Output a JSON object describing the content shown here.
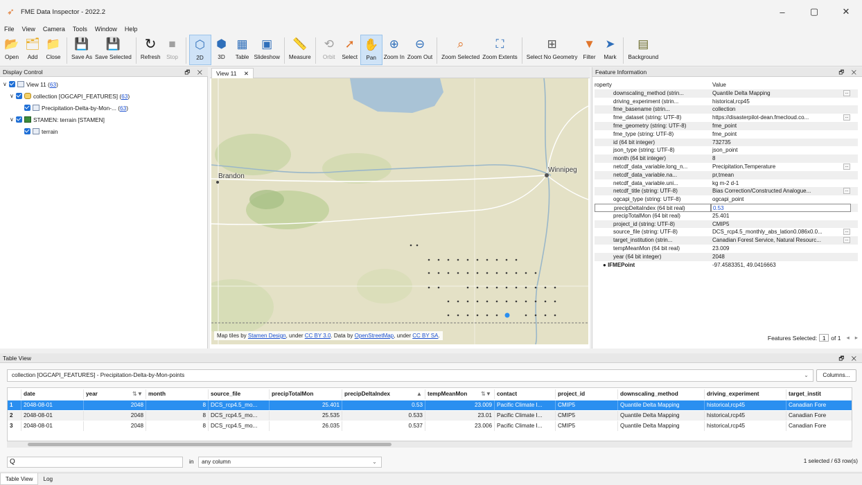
{
  "window": {
    "title": "FME Data Inspector - 2022.2",
    "controls": [
      "–",
      "▢",
      "✕"
    ]
  },
  "menu": [
    "File",
    "View",
    "Camera",
    "Tools",
    "Window",
    "Help"
  ],
  "toolbar": [
    {
      "label": "Open",
      "icon": "folder-open-icon",
      "glyph": "📂"
    },
    {
      "label": "Add",
      "icon": "add-icon",
      "glyph": "🗂"
    },
    {
      "label": "Close",
      "icon": "close-folder-icon",
      "glyph": "📁"
    },
    {
      "label": "Save As",
      "icon": "save-as-icon",
      "glyph": "💾"
    },
    {
      "label": "Save Selected",
      "icon": "save-selected-icon",
      "glyph": "💾"
    },
    {
      "label": "Refresh",
      "icon": "refresh-icon",
      "glyph": "↻"
    },
    {
      "label": "Stop",
      "icon": "stop-icon",
      "glyph": "■"
    },
    {
      "label": "2D",
      "icon": "2d-icon",
      "glyph": "⬡"
    },
    {
      "label": "3D",
      "icon": "3d-icon",
      "glyph": "⬢"
    },
    {
      "label": "Table",
      "icon": "table-icon",
      "glyph": "▦"
    },
    {
      "label": "Slideshow",
      "icon": "slideshow-icon",
      "glyph": "▣"
    },
    {
      "label": "Measure",
      "icon": "measure-icon",
      "glyph": "📏"
    },
    {
      "label": "Orbit",
      "icon": "orbit-icon",
      "glyph": "⟲"
    },
    {
      "label": "Select",
      "icon": "select-icon",
      "glyph": "➚"
    },
    {
      "label": "Pan",
      "icon": "pan-hand-icon",
      "glyph": "✋"
    },
    {
      "label": "Zoom In",
      "icon": "zoom-in-icon",
      "glyph": "⊕"
    },
    {
      "label": "Zoom Out",
      "icon": "zoom-out-icon",
      "glyph": "⊖"
    },
    {
      "label": "Zoom Selected",
      "icon": "zoom-selected-icon",
      "glyph": "⌕"
    },
    {
      "label": "Zoom Extents",
      "icon": "zoom-extents-icon",
      "glyph": "⛶"
    },
    {
      "label": "Select No Geometry",
      "icon": "select-no-geometry-icon",
      "glyph": "⊞"
    },
    {
      "label": "Filter",
      "icon": "filter-icon",
      "glyph": "▼"
    },
    {
      "label": "Mark",
      "icon": "mark-icon",
      "glyph": "➤"
    },
    {
      "label": "Background",
      "icon": "background-icon",
      "glyph": "▤"
    }
  ],
  "display_control": {
    "title": "Display Control",
    "controls": "🗗 ✕",
    "tree": [
      {
        "prefix": "View 11 (",
        "count": "63",
        "suffix": ")"
      },
      {
        "prefix": "collection [OGCAPI_FEATURES] (",
        "count": "63",
        "suffix": ")"
      },
      {
        "prefix": "Precipitation-Delta-by-Mon-... (",
        "count": "63",
        "suffix": ")"
      },
      {
        "prefix": "STAMEN: terrain [STAMEN]",
        "count": "",
        "suffix": ""
      },
      {
        "prefix": "terrain",
        "count": "",
        "suffix": ""
      }
    ]
  },
  "map_view": {
    "tab_label": "View 11",
    "tab_close": "✕",
    "labels": {
      "brandon": "Brandon",
      "winnipeg": "Winnipeg"
    },
    "attribution": {
      "p1": "Map tiles by ",
      "l1": "Stamen Design",
      "p2": ", under ",
      "l2": "CC BY 3.0",
      "p3": ". Data by ",
      "l3": "OpenStreetMap",
      "p4": ", under ",
      "l4": "CC BY SA",
      "p5": "."
    },
    "colors": {
      "land": "#e4e1c6",
      "water": "#a9c3d6",
      "point": "#3a3a3a",
      "selected_point": "#2a8ff0"
    }
  },
  "feature_info": {
    "title": "Feature Information",
    "controls": "🗗 ✕",
    "header": {
      "property": "roperty",
      "value": "Value"
    },
    "rows": [
      {
        "k": "downscaling_method (strin...",
        "v": "Quantile Delta Mapping",
        "more": true
      },
      {
        "k": "driving_experiment (strin...",
        "v": "historical,rcp45",
        "more": false
      },
      {
        "k": "fme_basename (strin...",
        "v": "collection",
        "more": false
      },
      {
        "k": "fme_dataset (string: UTF-8)",
        "v": "https://disasterpilot-dean.fmecloud.co...",
        "more": true
      },
      {
        "k": "fme_geometry (string: UTF-8)",
        "v": "fme_point",
        "more": false
      },
      {
        "k": "fme_type (string: UTF-8)",
        "v": "fme_point",
        "more": false
      },
      {
        "k": "id (64 bit integer)",
        "v": "732735",
        "more": false
      },
      {
        "k": "json_type (string: UTF-8)",
        "v": "json_point",
        "more": false
      },
      {
        "k": "month (64 bit integer)",
        "v": "8",
        "more": false
      },
      {
        "k": "netcdf_data_variable.long_n...",
        "v": "Precipitation,Temperature",
        "more": true
      },
      {
        "k": "netcdf_data_variable.na...",
        "v": "pr,tmean",
        "more": false
      },
      {
        "k": "netcdf_data_variable.uni...",
        "v": "kg m-2 d-1",
        "more": false
      },
      {
        "k": "netcdf_title (string: UTF-8)",
        "v": "Bias Correction/Constructed Analogue...",
        "more": true
      },
      {
        "k": "ogcapi_type (string: UTF-8)",
        "v": "ogcapi_point",
        "more": false
      },
      {
        "k": "precipDeltaIndex (64 bit real)",
        "v": "0.53",
        "more": false,
        "sel": true
      },
      {
        "k": "precipTotalMon (64 bit real)",
        "v": "25.401",
        "more": false
      },
      {
        "k": "project_id (string: UTF-8)",
        "v": "CMIP5",
        "more": false
      },
      {
        "k": "source_file (string: UTF-8)",
        "v": "DCS_rcp4.5_monthly_abs_lation0.086x0.0...",
        "more": true
      },
      {
        "k": "target_institution (strin...",
        "v": "Canadian Forest Service, Natural Resourc...",
        "more": true
      },
      {
        "k": "tempMeanMon (64 bit real)",
        "v": "23.009",
        "more": false
      },
      {
        "k": "year (64 bit integer)",
        "v": "2048",
        "more": false
      },
      {
        "k": "IFMEPoint",
        "v": "-97.4583351, 49.0416663",
        "more": false,
        "point": true
      }
    ],
    "features_selected": {
      "label": "Features Selected:",
      "current": "1",
      "of": "of 1",
      "prev": "◂",
      "next": "▸"
    }
  },
  "table_view": {
    "title": "Table View",
    "controls": "🗗 ✕",
    "dataset": "collection [OGCAPI_FEATURES] - Precipitation-Delta-by-Mon-points",
    "columns_button": "Columns...",
    "headers": [
      "",
      "date",
      "year",
      "⇅▼",
      "month",
      "source_file",
      "precipTotalMon",
      "precipDeltaIndex",
      "▲",
      "tempMeanMon",
      "⇅▼",
      "contact",
      "project_id",
      "downscaling_method",
      "driving_experiment",
      "target_instit"
    ],
    "rows": [
      [
        "1",
        "2048-08-01",
        "2048",
        "8",
        "DCS_rcp4.5_mo...",
        "25.401",
        "0.53",
        "23.009",
        "Pacific Climate I...",
        "CMIP5",
        "Quantile Delta Mapping",
        "historical,rcp45",
        "Canadian Fore"
      ],
      [
        "2",
        "2048-08-01",
        "2048",
        "8",
        "DCS_rcp4.5_mo...",
        "25.535",
        "0.533",
        "23.01",
        "Pacific Climate I...",
        "CMIP5",
        "Quantile Delta Mapping",
        "historical,rcp45",
        "Canadian Fore"
      ],
      [
        "3",
        "2048-08-01",
        "2048",
        "8",
        "DCS_rcp4.5_mo...",
        "26.035",
        "0.537",
        "23.006",
        "Pacific Climate I...",
        "CMIP5",
        "Quantile Delta Mapping",
        "historical,rcp45",
        "Canadian Fore"
      ]
    ],
    "search_icon": "Q",
    "in_label": "in",
    "column_select": "any column",
    "status": "1 selected / 63 row(s)"
  },
  "bottom_tabs": [
    "Table View",
    "Log"
  ]
}
